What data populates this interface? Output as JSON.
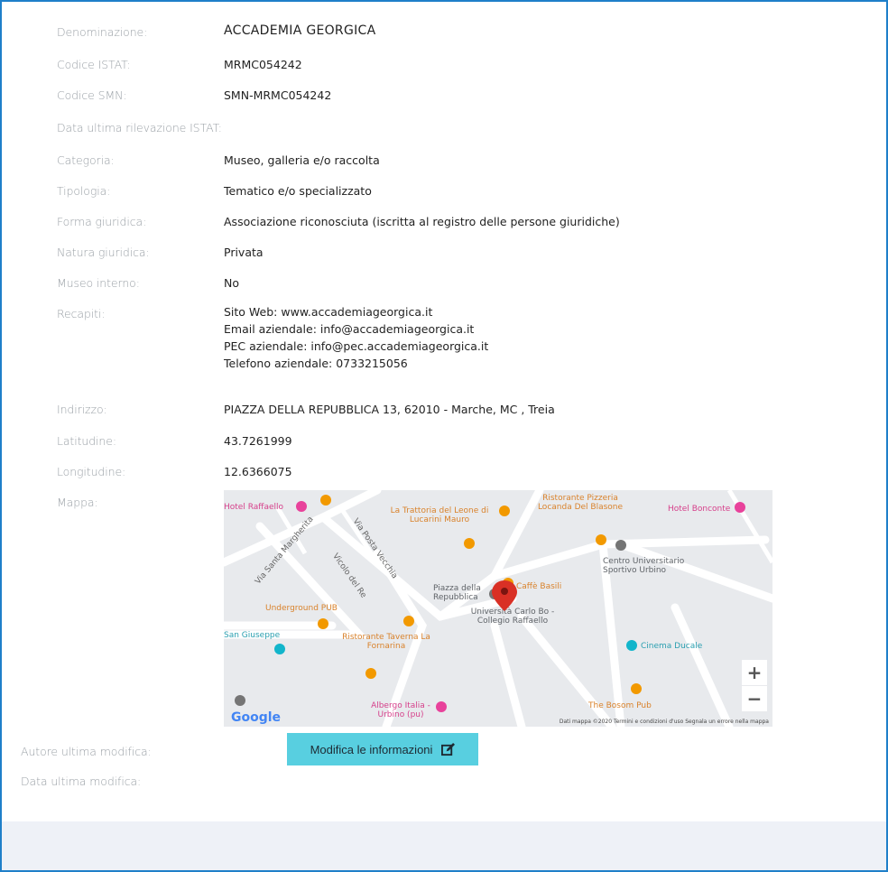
{
  "fields": {
    "denominazione": {
      "label": "Denominazione:",
      "value": "ACCADEMIA GEORGICA"
    },
    "codice_istat": {
      "label": "Codice ISTAT:",
      "value": "MRMC054242"
    },
    "codice_smn": {
      "label": "Codice SMN:",
      "value": "SMN-MRMC054242"
    },
    "data_rilevazione": {
      "label": "Data ultima rilevazione ISTAT:",
      "value": ""
    },
    "categoria": {
      "label": "Categoria:",
      "value": "Museo, galleria e/o raccolta"
    },
    "tipologia": {
      "label": "Tipologia:",
      "value": "Tematico e/o specializzato"
    },
    "forma_giuridica": {
      "label": "Forma giuridica:",
      "value": "Associazione riconosciuta (iscritta al registro delle persone giuridiche)"
    },
    "natura_giuridica": {
      "label": "Natura giuridica:",
      "value": "Privata"
    },
    "museo_interno": {
      "label": "Museo interno:",
      "value": "No"
    },
    "recapiti": {
      "label": "Recapiti:",
      "lines": [
        "Sito Web: www.accademiageorgica.it",
        "Email aziendale: info@accademiageorgica.it",
        "PEC aziendale: info@pec.accademiageorgica.it",
        "Telefono aziendale: 0733215056"
      ]
    },
    "indirizzo": {
      "label": "Indirizzo:",
      "value": "PIAZZA DELLA REPUBBLICA 13, 62010 - Marche, MC , Treia"
    },
    "latitudine": {
      "label": "Latitudine:",
      "value": "43.7261999"
    },
    "longitudine": {
      "label": "Longitudine:",
      "value": "12.6366075"
    },
    "mappa": {
      "label": "Mappa:"
    },
    "autore": {
      "label": "Autore ultima modifica:"
    },
    "data_modifica": {
      "label": "Data ultima modifica:"
    }
  },
  "map": {
    "places": [
      "Hotel Raffaello",
      "La Trattoria del Leone di Lucarini Mauro",
      "Ristorante Pizzeria Locanda Del Blasone",
      "Hotel Bonconte",
      "Centro Universitario Sportivo Urbino",
      "Piazza della Repubblica",
      "Caffè Basili",
      "Università Carlo Bo - Collegio Raffaello",
      "Underground PUB",
      "Ristorante Taverna La Fornarina",
      "San Giuseppe",
      "Cinema Ducale",
      "Albergo Italia - Urbino (pu)",
      "The Bosom Pub"
    ],
    "streets": [
      "Via Santa Margherita",
      "Via Posta Vecchia",
      "Vicolo del Re"
    ],
    "google_logo": "Google",
    "attribution": "Dati mappa ©2020   Termini e condizioni d'uso   Segnala un errore nella mappa",
    "zoom_in": "+",
    "zoom_out": "−",
    "colors": {
      "pin": "#d93025",
      "food": "#f29900",
      "road": "#ffffff",
      "bg": "#e8eaed"
    }
  },
  "edit_button": {
    "label": "Modifica le informazioni",
    "icon": "edit-icon"
  }
}
